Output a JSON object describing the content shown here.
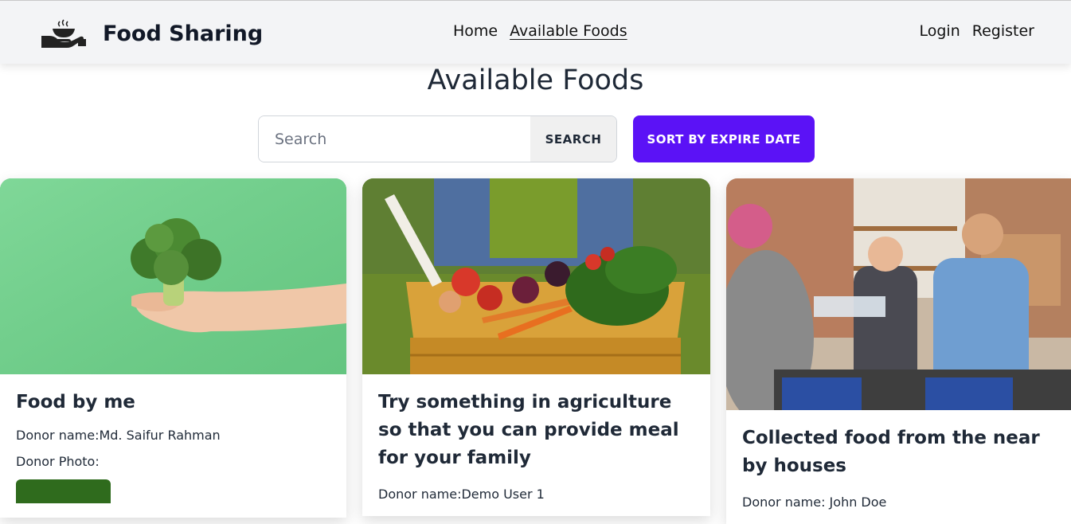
{
  "navbar": {
    "brand": "Food Sharing",
    "links": [
      "Home",
      "Available Foods"
    ],
    "login": "Login",
    "register": "Register"
  },
  "page": {
    "title": "Available Foods",
    "search_placeholder": "Search",
    "search_button": "SEARCH",
    "sort_button": "SORT BY EXPIRE DATE"
  },
  "cards": [
    {
      "title": "Food by me",
      "donor_name": "Donor name:Md. Saifur Rahman",
      "donor_photo_label": "Donor Photo:"
    },
    {
      "title": "Try something in agriculture so that you can provide meal for your family",
      "donor_name": "Donor name:Demo User 1"
    },
    {
      "title": "Collected food from the near by houses",
      "donor_name": "Donor name: John Doe"
    }
  ],
  "colors": {
    "accent": "#5b12f6",
    "navbar_bg": "#f3f4f6"
  }
}
